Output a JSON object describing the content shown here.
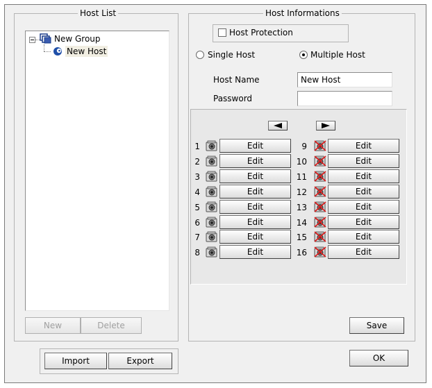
{
  "host_list": {
    "title": "Host List",
    "tree": {
      "group_label": "New Group",
      "host_label": "New Host"
    },
    "new_label": "New",
    "delete_label": "Delete",
    "import_label": "Import",
    "export_label": "Export"
  },
  "host_info": {
    "title": "Host Informations",
    "protection_label": "Host Protection",
    "protection_checked": false,
    "single_label": "Single Host",
    "multiple_label": "Multiple Host",
    "selected_mode": "Multiple Host",
    "host_name_label": "Host Name",
    "host_name_value": "New Host",
    "password_label": "Password",
    "password_value": "",
    "prev_icon": "arrow-left-icon",
    "next_icon": "arrow-right-icon",
    "save_label": "Save"
  },
  "channels_left": [
    {
      "num": "1",
      "label": "Edit",
      "icon": "camera-icon"
    },
    {
      "num": "2",
      "label": "Edit",
      "icon": "camera-icon"
    },
    {
      "num": "3",
      "label": "Edit",
      "icon": "camera-icon"
    },
    {
      "num": "4",
      "label": "Edit",
      "icon": "camera-icon"
    },
    {
      "num": "5",
      "label": "Edit",
      "icon": "camera-icon"
    },
    {
      "num": "6",
      "label": "Edit",
      "icon": "camera-icon"
    },
    {
      "num": "7",
      "label": "Edit",
      "icon": "camera-icon"
    },
    {
      "num": "8",
      "label": "Edit",
      "icon": "camera-icon"
    }
  ],
  "channels_right": [
    {
      "num": "9",
      "label": "Edit",
      "icon": "camera-disabled-icon"
    },
    {
      "num": "10",
      "label": "Edit",
      "icon": "camera-disabled-icon"
    },
    {
      "num": "11",
      "label": "Edit",
      "icon": "camera-disabled-icon"
    },
    {
      "num": "12",
      "label": "Edit",
      "icon": "camera-disabled-icon"
    },
    {
      "num": "13",
      "label": "Edit",
      "icon": "camera-disabled-icon"
    },
    {
      "num": "14",
      "label": "Edit",
      "icon": "camera-disabled-icon"
    },
    {
      "num": "15",
      "label": "Edit",
      "icon": "camera-disabled-icon"
    },
    {
      "num": "16",
      "label": "Edit",
      "icon": "camera-disabled-icon"
    }
  ],
  "ok_label": "OK"
}
